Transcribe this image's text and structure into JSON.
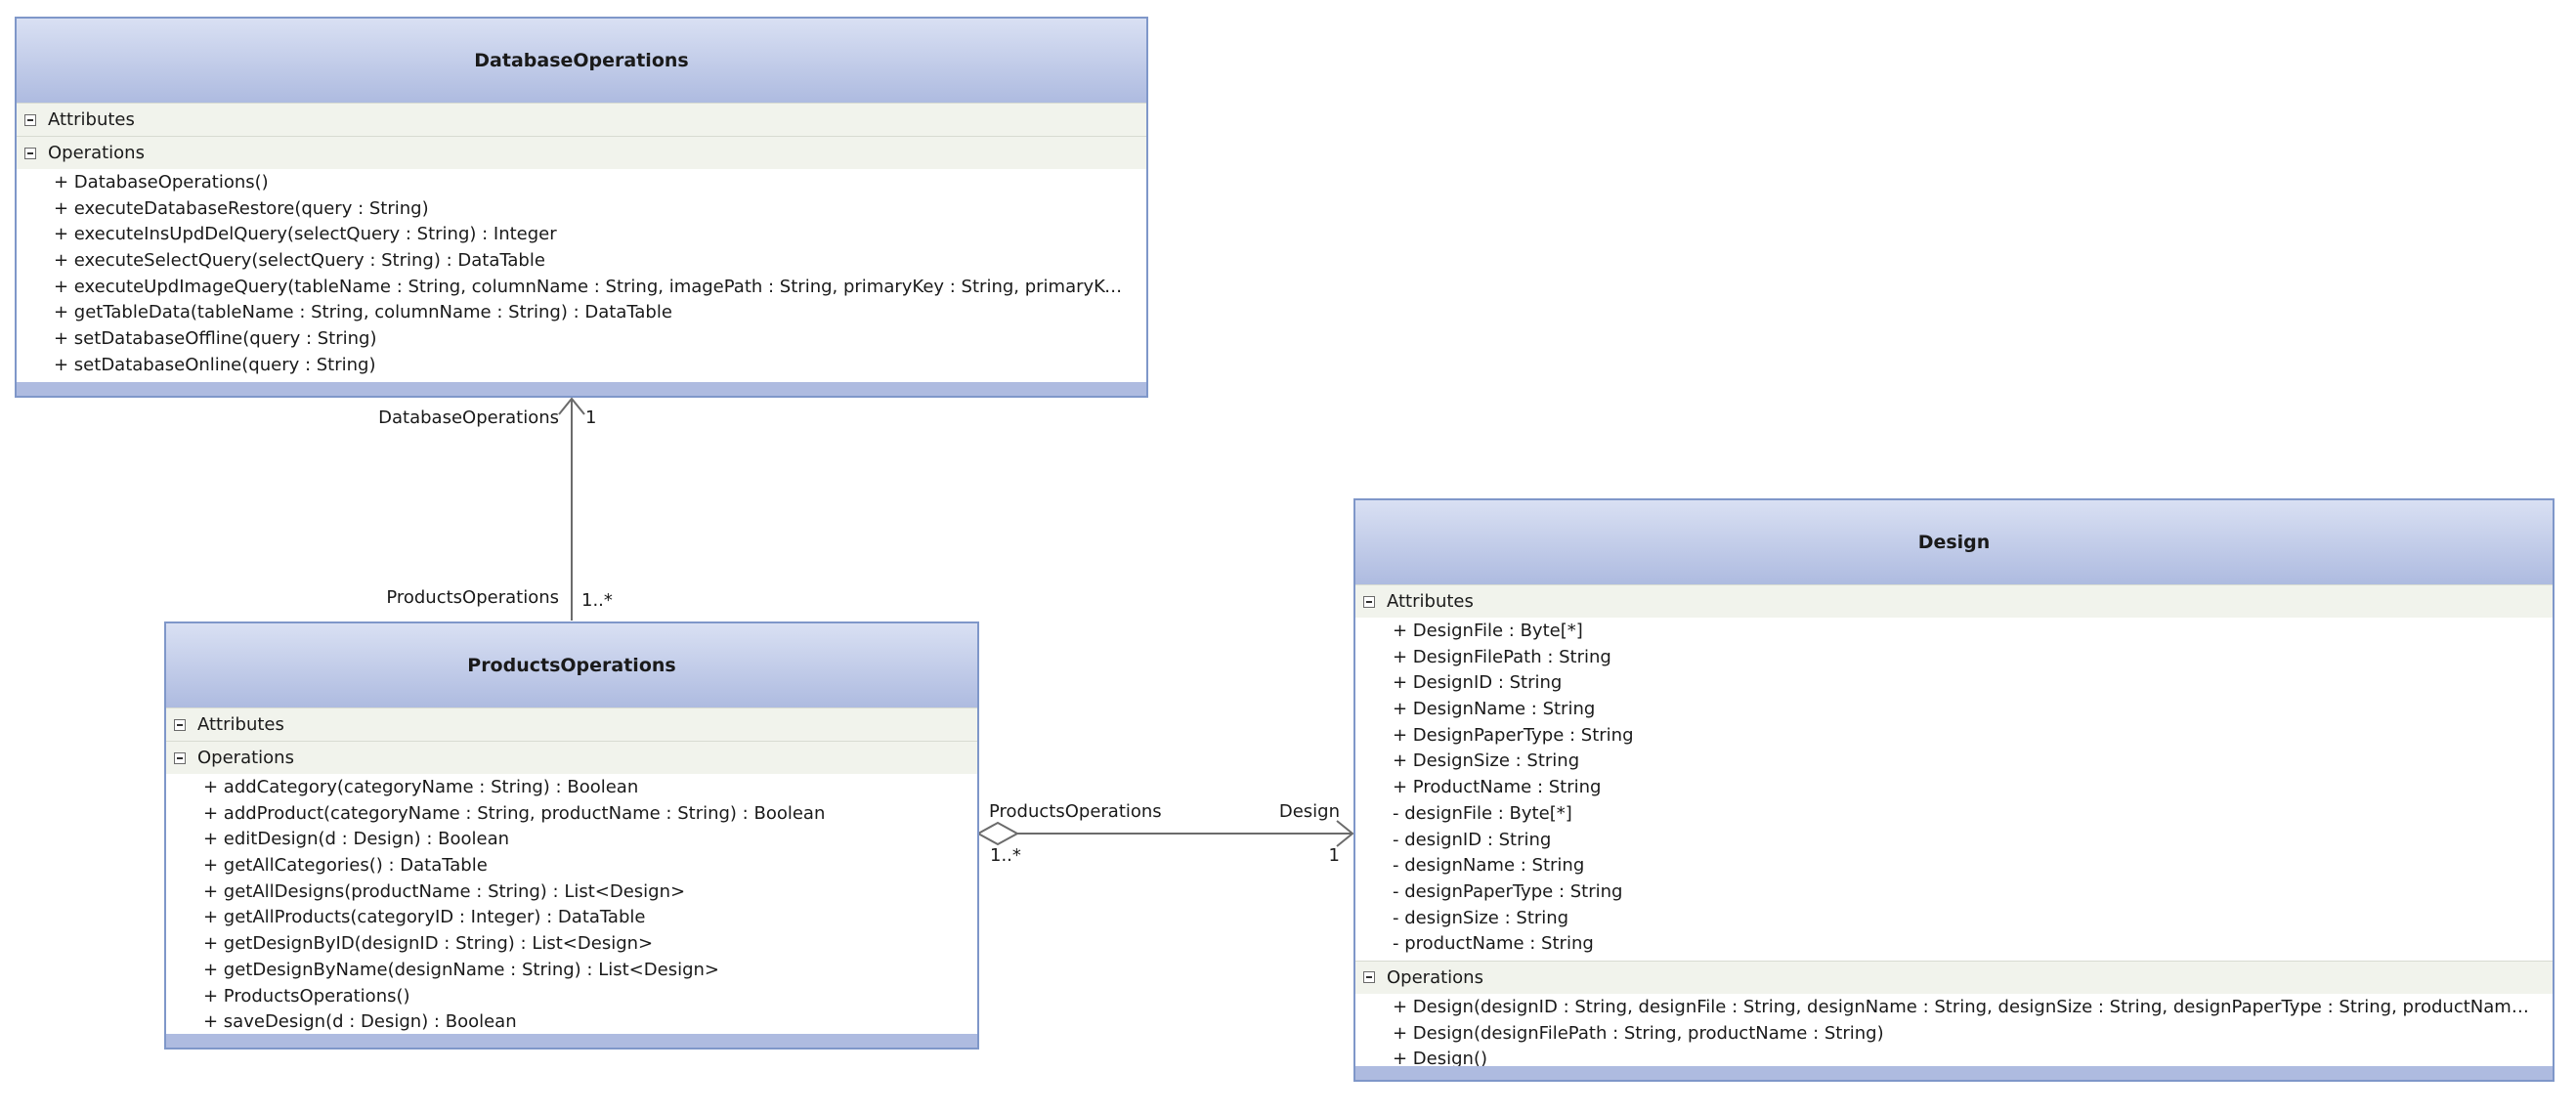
{
  "classes": {
    "database_operations": {
      "name": "DatabaseOperations",
      "attributes_label": "Attributes",
      "attributes": [],
      "operations_label": "Operations",
      "operations": [
        "+ DatabaseOperations()",
        "+ executeDatabaseRestore(query : String)",
        "+ executeInsUpdDelQuery(selectQuery : String) : Integer",
        "+ executeSelectQuery(selectQuery : String) : DataTable",
        "+ executeUpdImageQuery(tableName : String, columnName : String, imagePath : String, primaryKey : String, primaryKeyValue…",
        "+ getTableData(tableName : String, columnName : String) : DataTable",
        "+ setDatabaseOffline(query : String)",
        "+ setDatabaseOnline(query : String)"
      ]
    },
    "products_operations": {
      "name": "ProductsOperations",
      "attributes_label": "Attributes",
      "attributes": [],
      "operations_label": "Operations",
      "operations": [
        "+ addCategory(categoryName : String) : Boolean",
        "+ addProduct(categoryName : String, productName : String) : Boolean",
        "+ editDesign(d : Design) : Boolean",
        "+ getAllCategories() : DataTable",
        "+ getAllDesigns(productName : String) : List<Design>",
        "+ getAllProducts(categoryID : Integer) : DataTable",
        "+ getDesignByID(designID : String) : List<Design>",
        "+ getDesignByName(designName : String) : List<Design>",
        "+ ProductsOperations()",
        "+ saveDesign(d : Design) : Boolean"
      ]
    },
    "design": {
      "name": "Design",
      "attributes_label": "Attributes",
      "attributes": [
        "+ DesignFile : Byte[*]",
        "+ DesignFilePath : String",
        "+ DesignID : String",
        "+ DesignName : String",
        "+ DesignPaperType : String",
        "+ DesignSize : String",
        "+ ProductName : String",
        "- designFile : Byte[*]",
        "- designID : String",
        "- designName : String",
        "- designPaperType : String",
        "- designSize : String",
        "- productName : String"
      ],
      "operations_label": "Operations",
      "operations": [
        "+ Design(designID : String, designFile : String, designName : String, designSize : String, designPaperType : String, productName : String)",
        "+ Design(designFilePath : String, productName : String)",
        "+ Design()"
      ]
    }
  },
  "associations": {
    "products_to_database": {
      "target_role": "DatabaseOperations",
      "target_multiplicity": "1",
      "source_role": "ProductsOperations",
      "source_multiplicity": "1..*"
    },
    "products_to_design": {
      "source_role": "ProductsOperations",
      "source_multiplicity": "1..*",
      "target_role": "Design",
      "target_multiplicity": "1"
    }
  },
  "colors": {
    "border": "#7f97c9",
    "header_top": "#d9e0f3",
    "header_bottom": "#aebbe0",
    "compartment_bg": "#f1f3ec",
    "connector": "#6b6b6b"
  }
}
